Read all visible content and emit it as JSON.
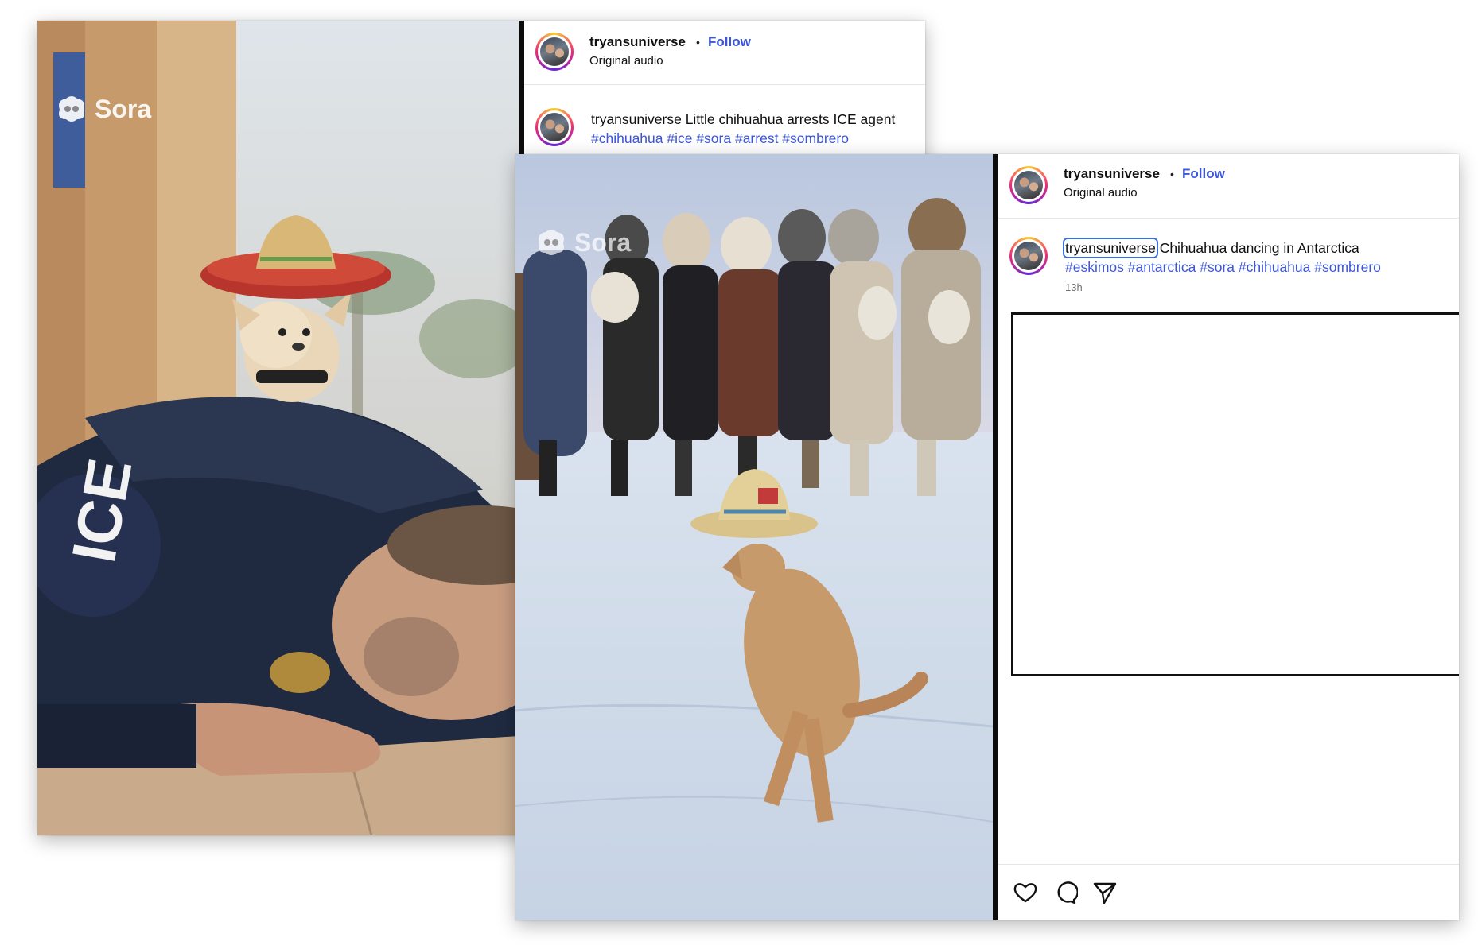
{
  "back_post": {
    "media": {
      "watermark": "Sora",
      "vest_text": "ICE"
    },
    "header": {
      "username": "tryansuniverse",
      "separator": "•",
      "follow": "Follow",
      "audio": "Original audio"
    },
    "caption": {
      "username": "tryansuniverse",
      "text": "Little chihuahua arrests ICE agent",
      "hashtags": "#chihuahua #ice #sora #arrest #sombrero"
    }
  },
  "front_post": {
    "media": {
      "watermark": "Sora"
    },
    "header": {
      "username": "tryansuniverse",
      "separator": "•",
      "follow": "Follow",
      "audio": "Original audio"
    },
    "caption": {
      "username": "tryansuniverse",
      "text": "Chihuahua dancing in Antarctica",
      "hashtags": "#eskimos #antarctica #sora #chihuahua #sombrero",
      "time": "13h"
    },
    "actions": [
      "heart-icon",
      "comment-icon",
      "share-icon"
    ]
  },
  "colors": {
    "link": "#3b56d8",
    "focus": "#3d6fdc",
    "divider": "#0c0c0c"
  }
}
